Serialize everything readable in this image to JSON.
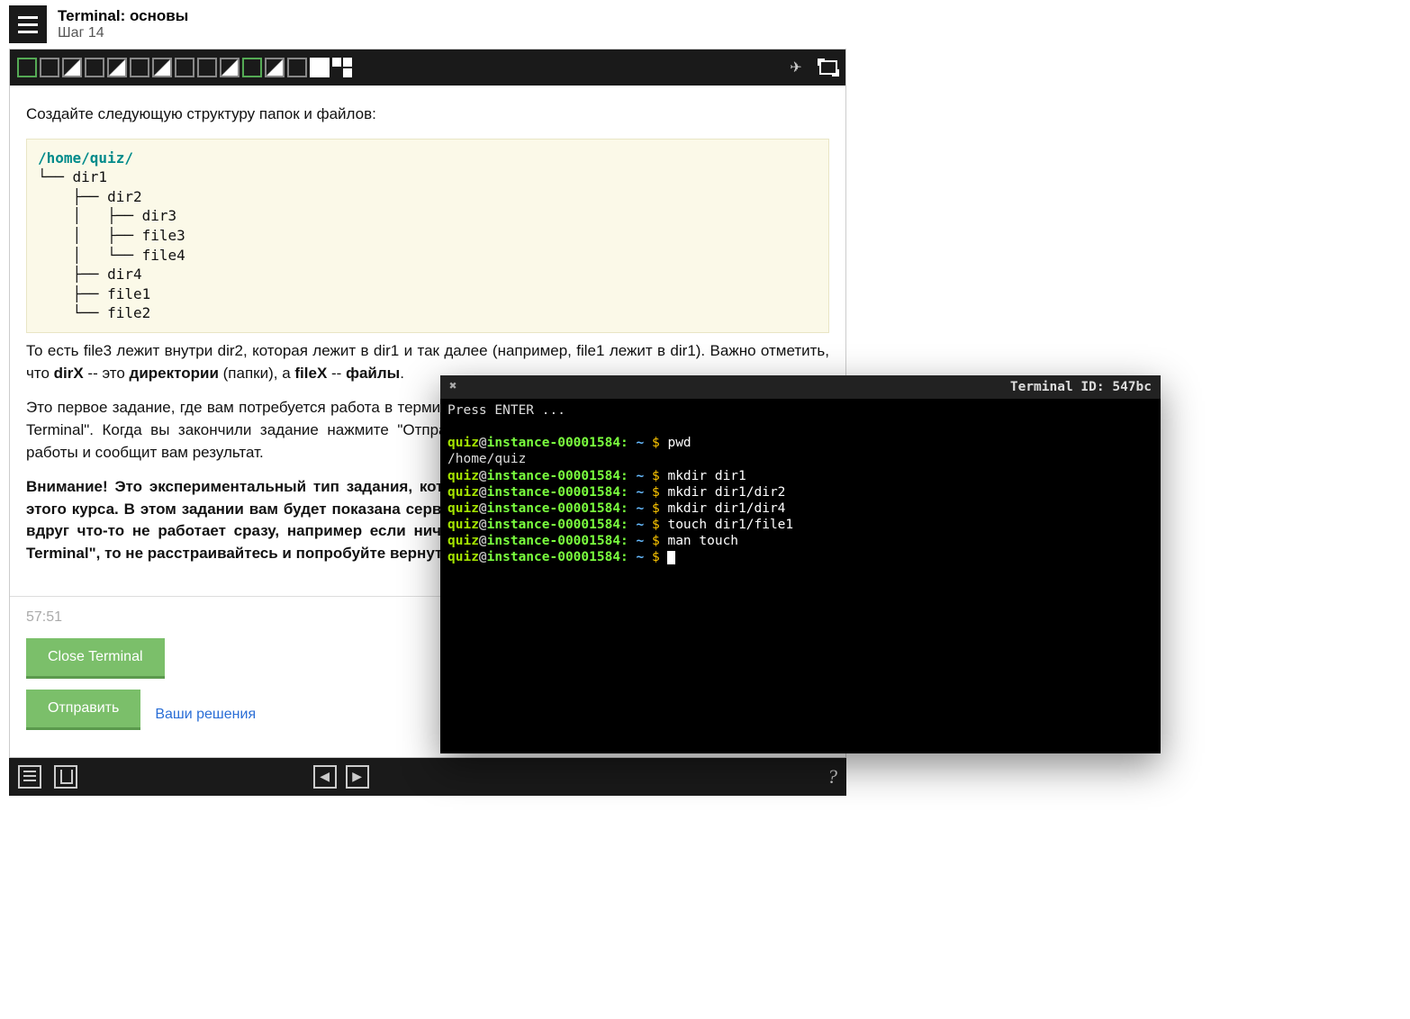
{
  "header": {
    "title": "Terminal: основы",
    "step": "Шаг 14"
  },
  "content": {
    "intro": "Создайте следующую структуру папок и файлов:",
    "tree_path": "/home/quiz/",
    "tree_body": "└── dir1\n    ├── dir2\n    │   ├── dir3\n    │   ├── file3\n    │   └── file4\n    ├── dir4\n    ├── file1\n    └── file2",
    "para1_a": "То есть file3 лежит внутри dir2, которая лежит в dir1 и так далее (например, file1 лежит в dir1). Важно отметить, что ",
    "para1_dirx": "dirX",
    "para1_b": " -- это ",
    "para1_dirs": "директории",
    "para1_c": " (папки), а ",
    "para1_filex": "fileX",
    "para1_d": " -- ",
    "para1_files": "файлы",
    "para1_e": ".",
    "para2": "Это первое задание, где вам потребуется работа в терминале. Чтобы открыть терминал нажмите кнопку \"Open Terminal\". Когда вы закончили задание нажмите \"Отправить\" -- робот проверит правильность выполнения работы и сообщит вам результат.",
    "para3": "Внимание! Это экспериментальный тип задания, который мы впервые используем именно в рамках этого курса. В этом задании вам будет показана серверная консоль прямо в окне браузера. Если у вас вдруг что-то не работает сразу, например если ничего не происходит по нажатию на кнопку \"Open Terminal\", то не расстраивайтесь и попробуйте вернуться к этому заданию позже."
  },
  "footer": {
    "timer": "57:51",
    "close_terminal": "Close Terminal",
    "submit": "Отправить",
    "solutions": "Ваши решения"
  },
  "terminal": {
    "id_label": "Terminal ID: 547bc",
    "press_enter": "Press ENTER ...",
    "prompt_user": "quiz",
    "prompt_at": "@",
    "prompt_host": "instance-00001584:",
    "prompt_path": " ~ ",
    "prompt_dollar": "$ ",
    "lines": [
      {
        "cmd": "pwd",
        "out": "/home/quiz"
      },
      {
        "cmd": "mkdir dir1"
      },
      {
        "cmd": "mkdir dir1/dir2"
      },
      {
        "cmd": "mkdir dir1/dir4"
      },
      {
        "cmd": "touch dir1/file1"
      },
      {
        "cmd": "man touch"
      }
    ]
  },
  "bottom_nav": {
    "prev": "◀",
    "next": "▶",
    "help": "?"
  }
}
